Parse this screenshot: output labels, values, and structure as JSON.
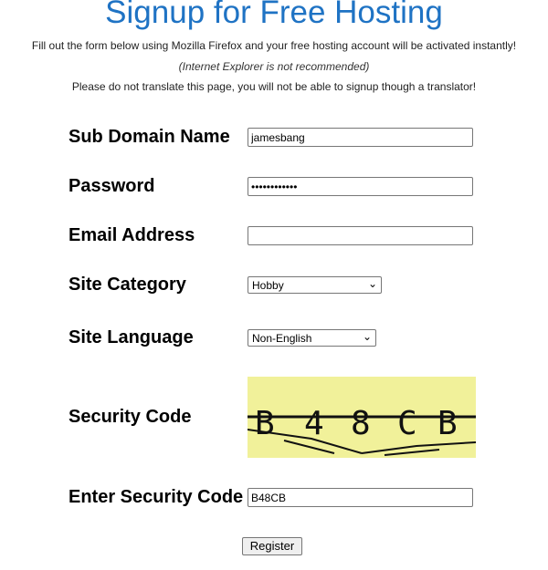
{
  "header": {
    "title": "Signup for Free Hosting",
    "line1": "Fill out the form below using Mozilla Firefox and your free hosting account will be activated instantly!",
    "line2": "(Internet Explorer is not recommended)",
    "line3": "Please do not translate this page, you will not be able to signup though a translator!"
  },
  "form": {
    "subdomain": {
      "label": "Sub Domain Name",
      "value": "jamesbang"
    },
    "password": {
      "label": "Password",
      "value": "••••••••••••"
    },
    "email": {
      "label": "Email Address",
      "value": ""
    },
    "category": {
      "label": "Site Category",
      "selected": "Hobby"
    },
    "language": {
      "label": "Site Language",
      "selected": "Non-English"
    },
    "security": {
      "label": "Security Code",
      "captcha_text": "B48CB"
    },
    "enter_code": {
      "label": "Enter Security Code",
      "value": "B48CB"
    },
    "register_label": "Register"
  },
  "colors": {
    "title": "#1f73c4",
    "captcha_bg": "#f1f19a"
  }
}
